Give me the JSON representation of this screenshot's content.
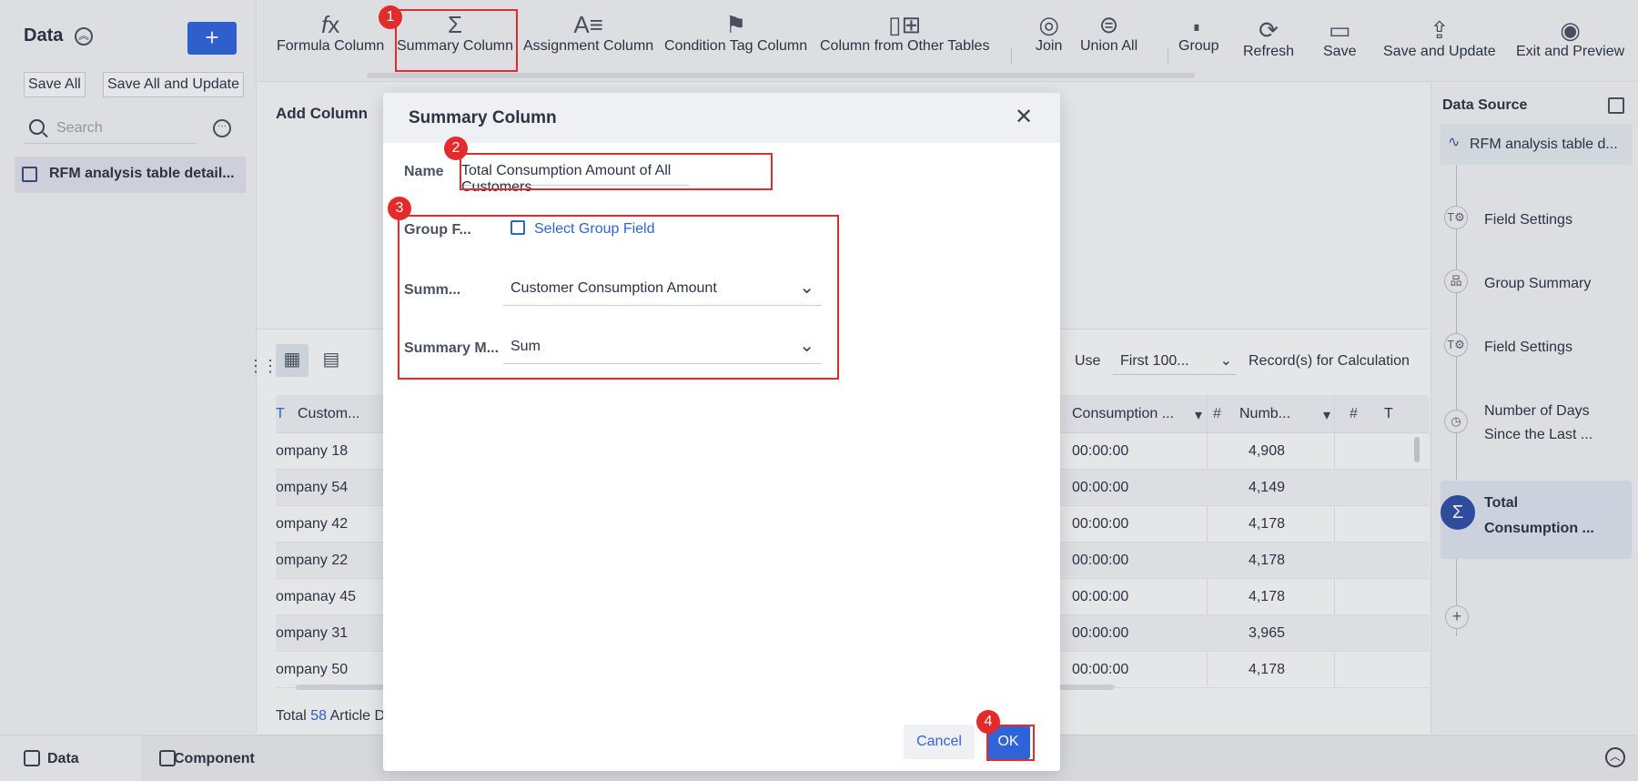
{
  "left": {
    "title": "Data",
    "save_all": "Save All",
    "save_all_update": "Save All and Update",
    "search_placeholder": "Search",
    "table_item": "RFM analysis table detail..."
  },
  "toolbar": {
    "formula": "Formula Column",
    "summary": "Summary Column",
    "assignment": "Assignment Column",
    "condition_tag": "Condition Tag Column",
    "from_other": "Column from Other Tables",
    "join": "Join",
    "union_all": "Union All",
    "group": "Group",
    "refresh": "Refresh",
    "save": "Save",
    "save_update": "Save and Update",
    "exit_preview": "Exit and Preview"
  },
  "main": {
    "add_column": "Add Column",
    "use": "Use",
    "use_select": "First 100...",
    "records": "Record(s) for Calculation",
    "headers": [
      "Custom...",
      "Consumption ...",
      "Numb...",
      "T"
    ],
    "rows": [
      {
        "customer": "ompany 18",
        "time": "00:00:00",
        "num": "4,908"
      },
      {
        "customer": "ompany 54",
        "time": "00:00:00",
        "num": "4,149"
      },
      {
        "customer": "ompany 42",
        "time": "00:00:00",
        "num": "4,178"
      },
      {
        "customer": "ompany 22",
        "time": "00:00:00",
        "num": "4,178"
      },
      {
        "customer": "ompanay 45",
        "time": "00:00:00",
        "num": "4,178"
      },
      {
        "customer": "ompany 31",
        "time": "00:00:00",
        "num": "3,965"
      },
      {
        "customer": "ompany 50",
        "time": "00:00:00",
        "num": "4,178"
      }
    ],
    "total_label": "Total",
    "total_num": "58",
    "total_suffix": "Article D"
  },
  "right": {
    "title": "Data Source",
    "source": "RFM analysis table d...",
    "steps": [
      "Field Settings",
      "Group Summary",
      "Field Settings"
    ],
    "days_line1": "Number of Days",
    "days_line2": "Since the Last ...",
    "active_line1": "Total",
    "active_line2": "Consumption ..."
  },
  "bottom": {
    "data_tab": "Data",
    "component_tab": "Component"
  },
  "modal": {
    "title": "Summary Column",
    "name_label": "Name",
    "name_value": "Total Consumption Amount of All Customers",
    "group_label": "Group F...",
    "group_btn": "Select Group Field",
    "summary_label": "Summ...",
    "summary_value": "Customer Consumption Amount",
    "method_label": "Summary M...",
    "method_value": "Sum",
    "cancel": "Cancel",
    "ok": "OK"
  },
  "annotations": [
    "1",
    "2",
    "3",
    "4"
  ],
  "colors": {
    "accent": "#2f64d9",
    "annotation": "#e32b2b"
  }
}
